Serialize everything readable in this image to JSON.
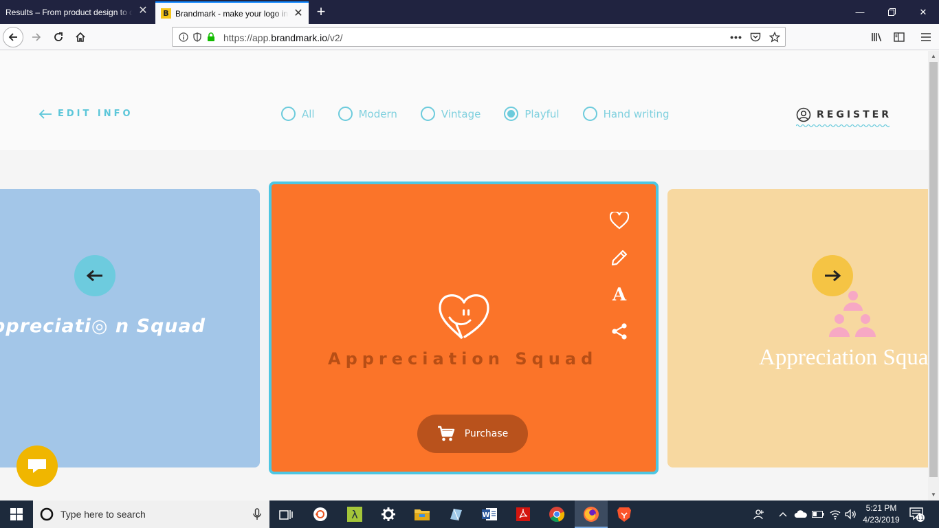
{
  "browser": {
    "tabs": [
      {
        "title": "Results – From product design to de",
        "active": false
      },
      {
        "title": "Brandmark - make your logo in",
        "active": true,
        "favicon": "B"
      }
    ],
    "url_prefix": "https://app.",
    "url_host": "brandmark.io",
    "url_path": "/v2/"
  },
  "header": {
    "edit_info": "EDIT INFO",
    "filters": [
      {
        "label": "All",
        "checked": false
      },
      {
        "label": "Modern",
        "checked": false
      },
      {
        "label": "Vintage",
        "checked": false
      },
      {
        "label": "Playful",
        "checked": true
      },
      {
        "label": "Hand writing",
        "checked": false
      }
    ],
    "register": "REGISTER"
  },
  "cards": {
    "left": {
      "text": "ppreciati◎ n Squad",
      "bg": "#a3c6e8"
    },
    "center": {
      "text": "Appreciation Squad",
      "bg": "#fb7429",
      "purchase_label": "Purchase"
    },
    "right": {
      "text": "Appreciation Squa",
      "bg": "#f7d8a0"
    }
  },
  "taskbar": {
    "search_placeholder": "Type here to search",
    "time": "5:21 PM",
    "date": "4/23/2019",
    "notification_count": "11"
  },
  "colors": {
    "accent": "#5bc6d9",
    "purchase": "#b9521c",
    "chat": "#f0b600"
  }
}
